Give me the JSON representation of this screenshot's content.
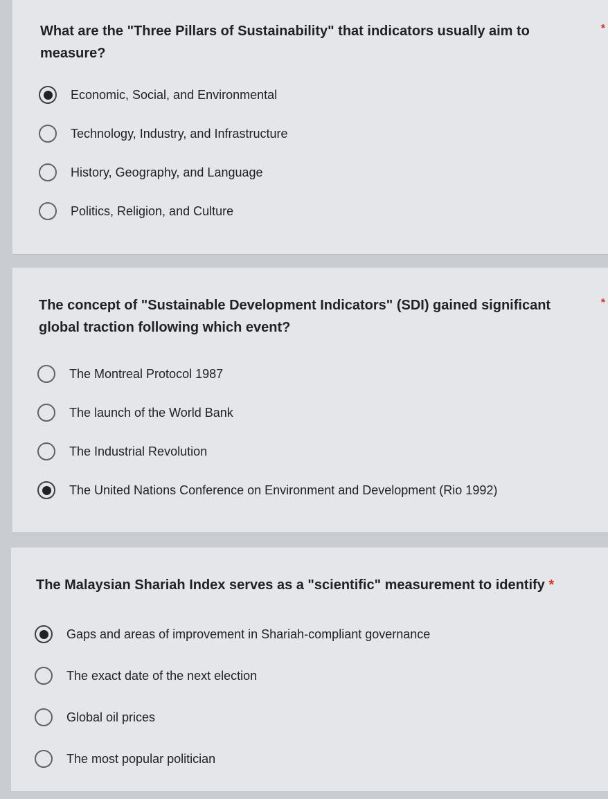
{
  "questions": [
    {
      "text": "What are the \"Three Pillars of Sustainability\" that indicators usually aim to measure?",
      "required_mark": "*",
      "options": [
        {
          "label": "Economic, Social, and Environmental",
          "selected": true
        },
        {
          "label": "Technology, Industry, and Infrastructure",
          "selected": false
        },
        {
          "label": "History, Geography, and Language",
          "selected": false
        },
        {
          "label": "Politics, Religion, and Culture",
          "selected": false
        }
      ]
    },
    {
      "text": "The concept of \"Sustainable Development Indicators\" (SDI) gained significant global traction following which event?",
      "required_mark": "*",
      "options": [
        {
          "label": "The Montreal Protocol 1987",
          "selected": false
        },
        {
          "label": "The launch of the World Bank",
          "selected": false
        },
        {
          "label": "The Industrial Revolution",
          "selected": false
        },
        {
          "label": "The United Nations Conference on Environment and Development (Rio 1992)",
          "selected": true
        }
      ]
    },
    {
      "text": "The Malaysian Shariah Index serves as a \"scientific\" measurement to identify",
      "required_mark": "*",
      "options": [
        {
          "label": "Gaps and areas of improvement in Shariah-compliant governance",
          "selected": true
        },
        {
          "label": "The exact date of the next election",
          "selected": false
        },
        {
          "label": "Global oil prices",
          "selected": false
        },
        {
          "label": "The most popular politician",
          "selected": false
        }
      ]
    }
  ],
  "colors": {
    "background": "#c9ccd0",
    "card": "#e4e6ea",
    "text": "#202124",
    "required": "#d93025",
    "radio_border": "#5f6368"
  }
}
